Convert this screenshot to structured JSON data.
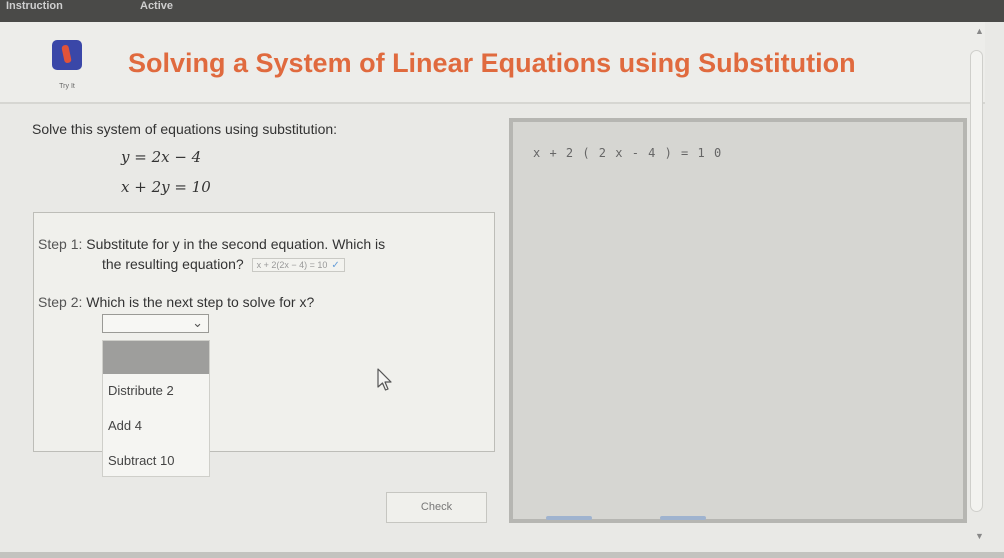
{
  "topbar": {
    "tab_left": "Instruction",
    "tab_right": "Active"
  },
  "header": {
    "logo_caption": "Try It",
    "title": "Solving a System of Linear Equations using Substitution"
  },
  "problem": {
    "prompt": "Solve this system of equations using substitution:",
    "equation_1": "y = 2x − 4",
    "equation_2": "x + 2y = 10"
  },
  "step1": {
    "label": "Step 1:",
    "text_line1": "Substitute for y in the second equation. Which is",
    "text_line2": "the resulting equation?",
    "selected_answer": "x + 2(2x − 4) = 10"
  },
  "step2": {
    "label": "Step 2:",
    "text": "Which is the next step to solve for x?",
    "selected_value": ""
  },
  "menu": {
    "options": [
      "Distribute 2",
      "Add 4",
      "Subtract 10"
    ]
  },
  "check_label": "Check",
  "workpad": {
    "equation": "x + 2 ( 2 x - 4 ) = 1 0"
  },
  "colors": {
    "title": "#e06a3e",
    "logo": "#3a47a8"
  }
}
